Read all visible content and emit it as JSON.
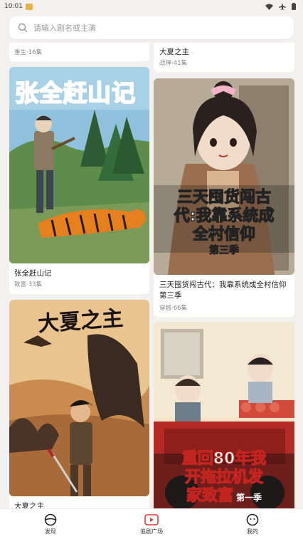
{
  "status_bar": {
    "time": "10:01"
  },
  "search": {
    "placeholder": "请输入剧名或主演"
  },
  "left_column": {
    "top_partial_meta": "重生·16集",
    "cards": [
      {
        "poster_title": "张全赶山记",
        "title": "张全赶山记",
        "meta": "致富·33集"
      },
      {
        "poster_title": "大夏之主",
        "title": "大夏之主",
        "meta": ""
      }
    ]
  },
  "right_column": {
    "top_partial": {
      "title": "大夏之主",
      "meta": "战神·41集"
    },
    "cards": [
      {
        "poster_title_lines": [
          "三天囤货闯古",
          "代:我靠系统成",
          "全村信仰",
          "第三季"
        ],
        "title": "三天囤货闯古代：我靠系统成全村信仰第三季",
        "meta": "穿越·66集"
      },
      {
        "poster_title_lines": [
          "重回80年我",
          "开拖拉机发",
          "家致富",
          "第一季"
        ],
        "title": "",
        "meta": ""
      }
    ]
  },
  "bottom_nav": {
    "items": [
      {
        "label": "发现",
        "icon": "discover-icon"
      },
      {
        "label": "追剧广场",
        "icon": "drama-square-icon"
      },
      {
        "label": "我的",
        "icon": "profile-icon"
      }
    ]
  },
  "colors": {
    "background": "#f3f1ef",
    "card": "#ffffff",
    "poster_red": "#e3262a"
  }
}
